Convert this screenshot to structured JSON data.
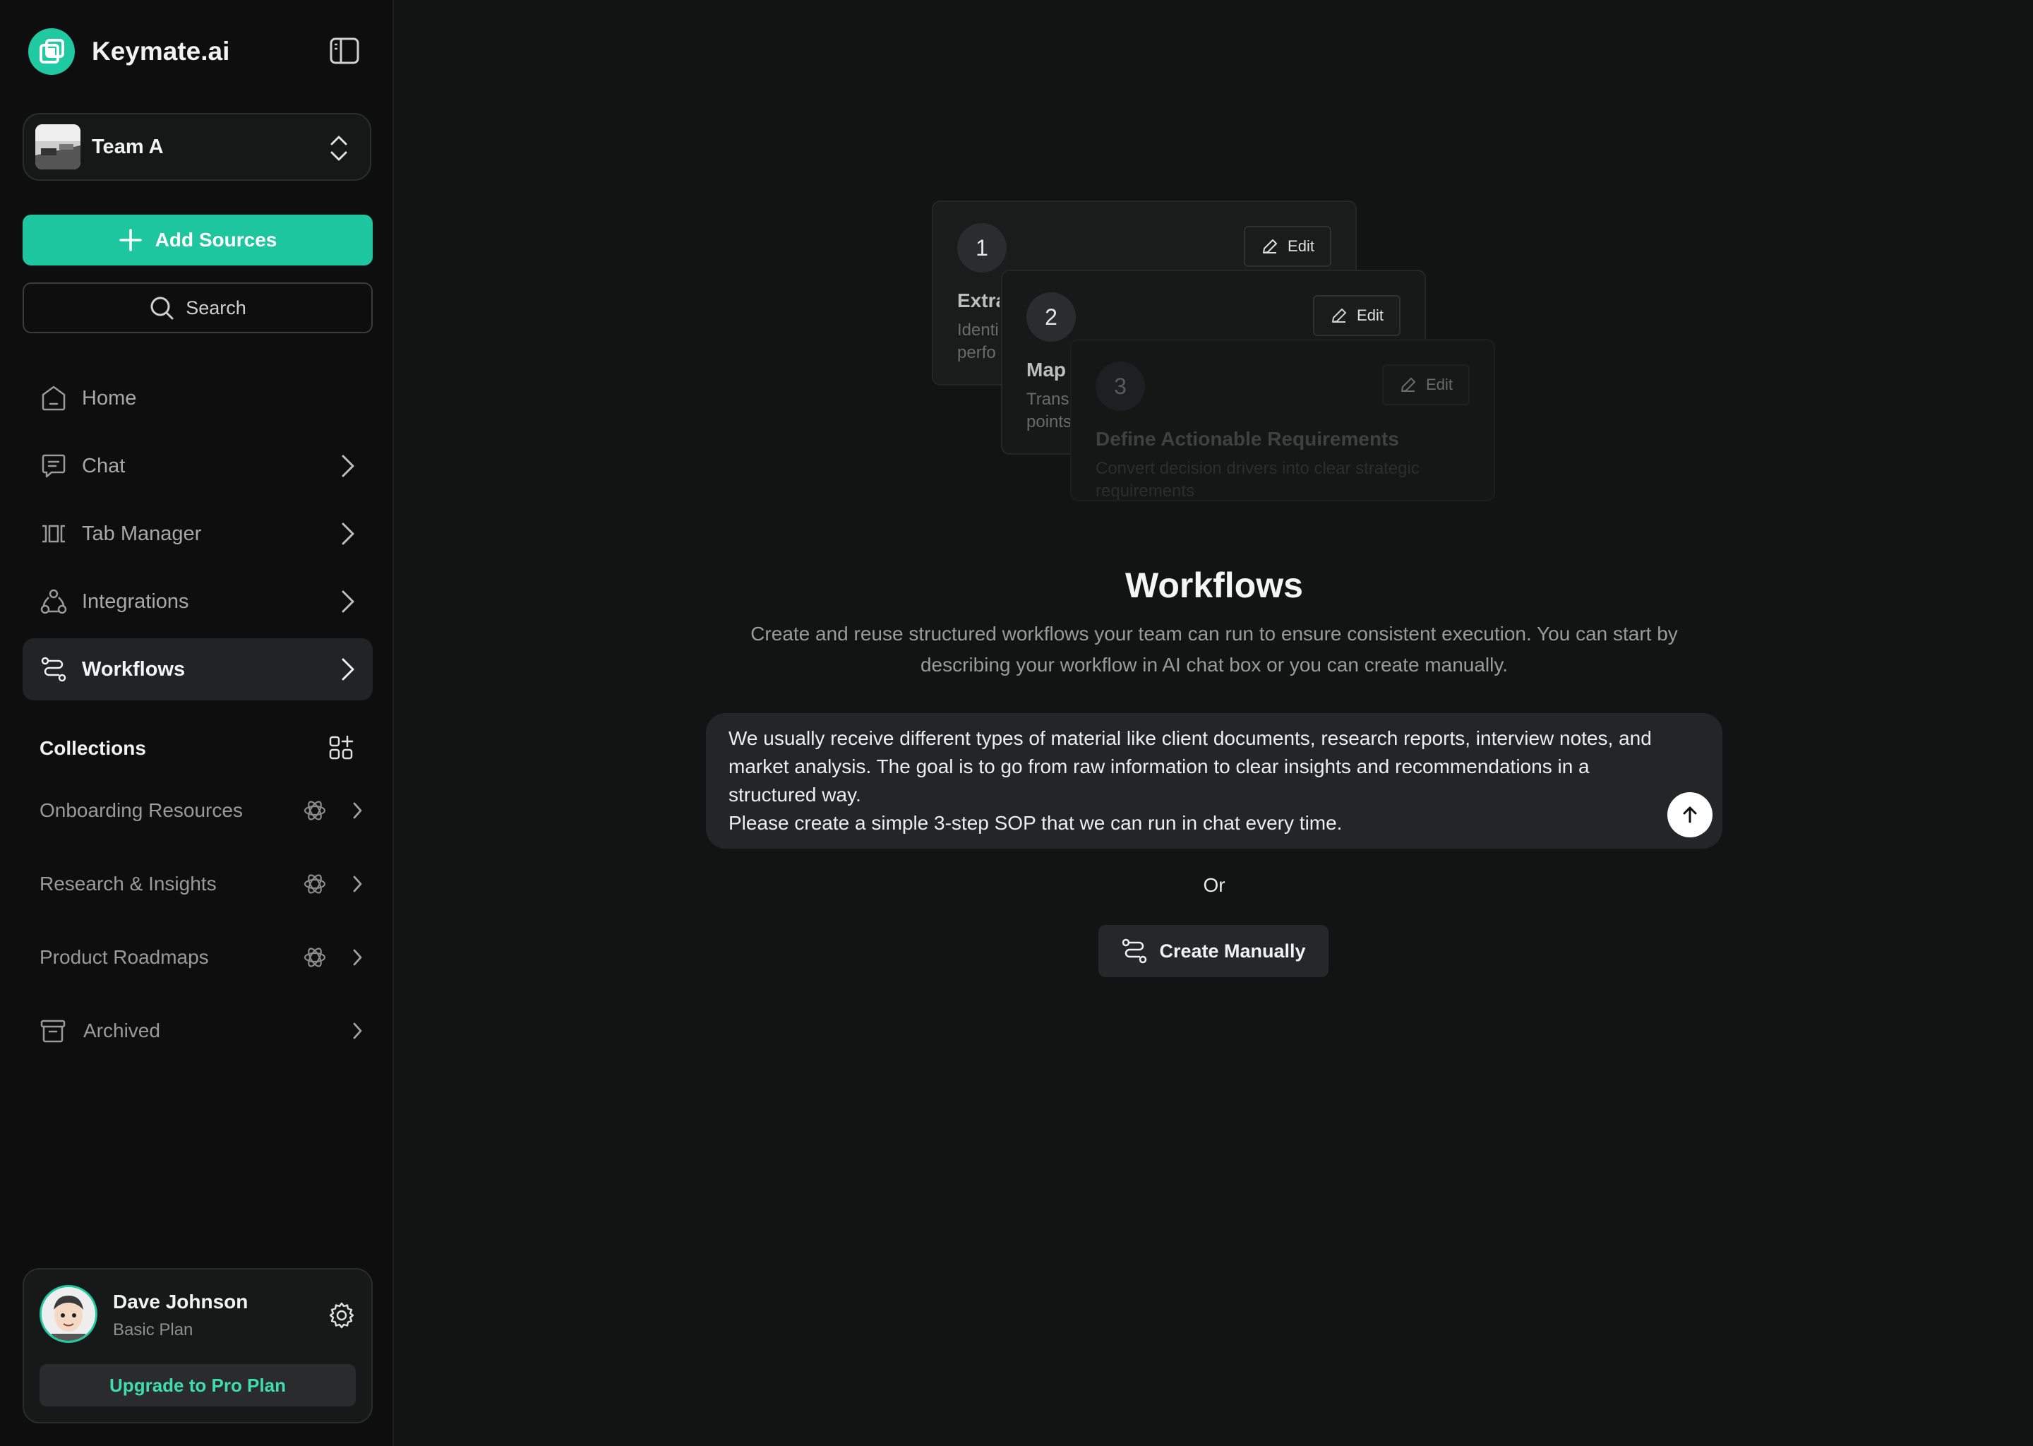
{
  "app": {
    "name": "Keymate.ai"
  },
  "team": {
    "name": "Team A"
  },
  "sidebar": {
    "add_sources_label": "Add Sources",
    "search_label": "Search",
    "nav": [
      {
        "label": "Home",
        "icon": "home-icon"
      },
      {
        "label": "Chat",
        "icon": "chat-icon"
      },
      {
        "label": "Tab Manager",
        "icon": "tab-manager-icon"
      },
      {
        "label": "Integrations",
        "icon": "integrations-icon"
      },
      {
        "label": "Workflows",
        "icon": "workflows-icon",
        "active": true
      }
    ],
    "collections_title": "Collections",
    "collections": [
      {
        "label": "Onboarding Resources",
        "icon": "openai-icon"
      },
      {
        "label": "Research & Insights",
        "icon": "openai-icon"
      },
      {
        "label": "Product Roadmaps",
        "icon": "openai-icon"
      }
    ],
    "archived_label": "Archived"
  },
  "user": {
    "name": "Dave Johnson",
    "plan": "Basic Plan",
    "upgrade_label": "Upgrade to Pro Plan"
  },
  "preview_steps": [
    {
      "number": "1",
      "edit_label": "Edit",
      "title": "Extra",
      "desc": "Identi perfo"
    },
    {
      "number": "2",
      "edit_label": "Edit",
      "title": "Map",
      "desc": "Trans points"
    },
    {
      "number": "3",
      "edit_label": "Edit",
      "title": "Define Actionable Requirements",
      "desc": "Convert decision drivers into clear strategic requirements"
    }
  ],
  "main": {
    "title": "Workflows",
    "description": "Create and reuse structured workflows your team can run to ensure consistent execution. You can start by describing your workflow in AI chat box or you can create manually.",
    "prompt_line1": "We usually receive different types of material like client documents, research reports, interview notes, and market analysis. The goal is to go from raw information to clear insights and recommendations in a structured way.",
    "prompt_line2": "Please create a simple 3-step SOP that we can run in chat every time.",
    "or_label": "Or",
    "create_manually_label": "Create Manually"
  },
  "colors": {
    "accent": "#1ec6a0",
    "background": "#121313",
    "sidebar": "#0e0e0e"
  }
}
